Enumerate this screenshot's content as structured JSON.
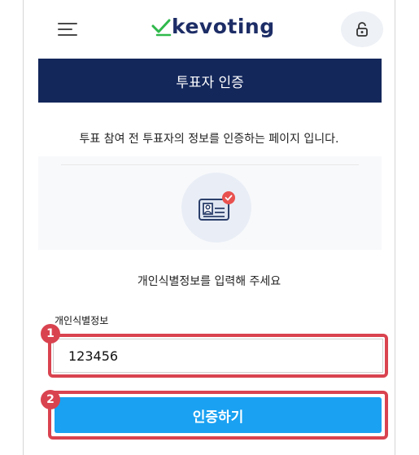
{
  "header": {
    "logo_text": "kevoting",
    "logo_icon": "check-leaf-icon",
    "menu_icon": "hamburger-menu-icon",
    "lock_icon": "unlock-icon"
  },
  "page": {
    "title": "투표자 인증",
    "description": "투표 참여 전 투표자의 정보를 인증하는 페이지 입니다.",
    "illustration_icon": "id-card-check-icon",
    "instruction": "개인식별정보를 입력해 주세요"
  },
  "form": {
    "field_label": "개인식별정보",
    "field_value": "123456",
    "submit_label": "인증하기"
  },
  "annotations": {
    "step_1": "1",
    "step_2": "2"
  },
  "colors": {
    "brand_navy": "#13275b",
    "brand_green": "#2fb84b",
    "button_blue": "#1aa1f2",
    "highlight_red": "#d9434f"
  }
}
